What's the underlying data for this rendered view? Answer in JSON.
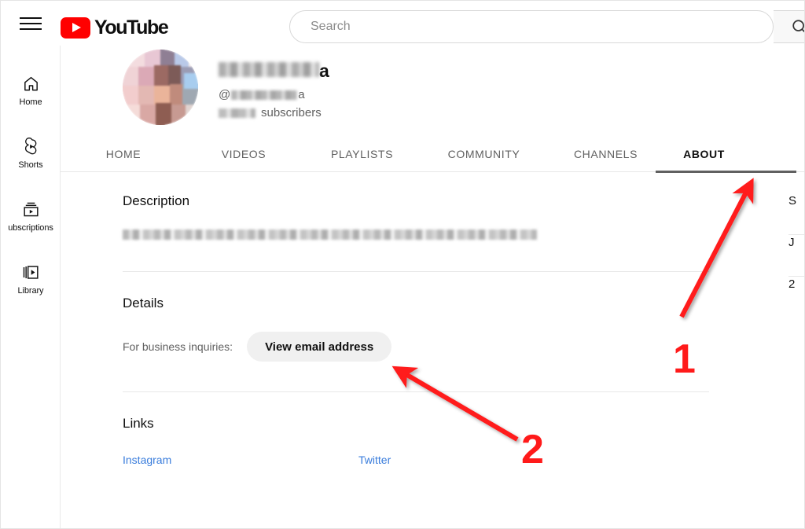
{
  "topbar": {
    "menu_icon": "hamburger-menu-icon",
    "logo_text": "YouTube",
    "logo_icon": "youtube-play-icon",
    "search": {
      "placeholder": "Search",
      "value": "",
      "button_icon": "search-icon"
    }
  },
  "sidebar": {
    "items": [
      {
        "label": "Home",
        "icon": "home-icon"
      },
      {
        "label": "Shorts",
        "icon": "shorts-icon"
      },
      {
        "label": "ubscriptions",
        "icon": "subscriptions-icon"
      },
      {
        "label": "Library",
        "icon": "library-icon"
      }
    ]
  },
  "channel": {
    "avatar_icon": "channel-avatar-blurred",
    "name_visible_tail": "a",
    "name_redacted": true,
    "handle_prefix": "@",
    "handle_visible_tail": "a",
    "handle_redacted": true,
    "subscribers_label": "subscribers",
    "subscribers_count_redacted": true
  },
  "tabs": [
    {
      "label": "HOME",
      "active": false
    },
    {
      "label": "VIDEOS",
      "active": false
    },
    {
      "label": "PLAYLISTS",
      "active": false
    },
    {
      "label": "COMMUNITY",
      "active": false
    },
    {
      "label": "CHANNELS",
      "active": false
    },
    {
      "label": "ABOUT",
      "active": true
    }
  ],
  "sections": {
    "description": {
      "title": "Description",
      "body_redacted": true
    },
    "details": {
      "title": "Details",
      "business_label": "For business inquiries:",
      "view_email_button": "View email address"
    },
    "links": {
      "title": "Links",
      "items": [
        {
          "label": "Instagram"
        },
        {
          "label": "Twitter"
        }
      ]
    }
  },
  "right_column": {
    "clipped_lines": [
      "S",
      "J",
      "2"
    ]
  },
  "annotations": {
    "markers": [
      {
        "label": "1",
        "target": "about-tab"
      },
      {
        "label": "2",
        "target": "view-email-button"
      }
    ],
    "color": "#ff1a1a"
  },
  "colors": {
    "brand_red": "#ff0000",
    "annotation_red": "#ff1a1a",
    "link_blue": "#3a7ddc",
    "text_primary": "#0f0f0f",
    "text_secondary": "#606060",
    "button_bg": "#f0f0f0",
    "divider": "#e8e8e8"
  }
}
